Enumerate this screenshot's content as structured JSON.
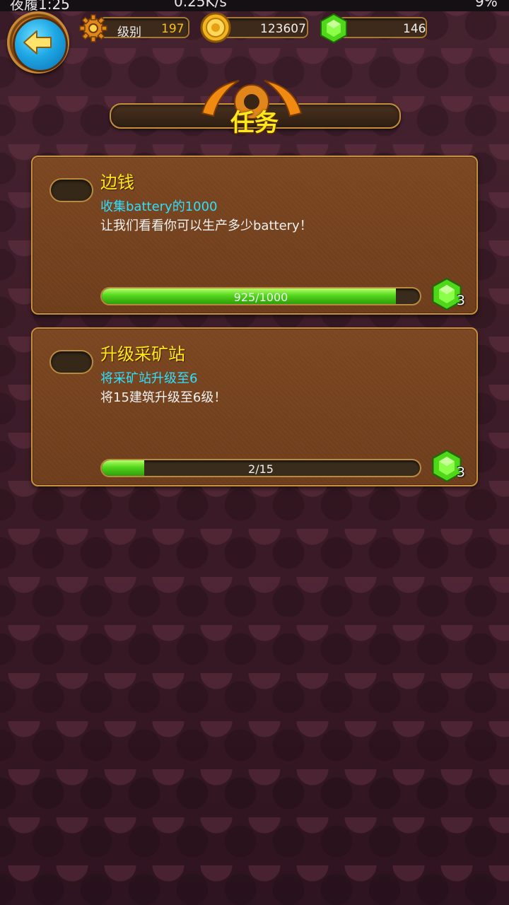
{
  "status_bar": {
    "left": "夜履1:25",
    "center": "0.25K/s",
    "right": "9%"
  },
  "header": {
    "level_label": "级别",
    "level_value": "197",
    "coins": "123607",
    "gems": "146"
  },
  "title": "任务",
  "quests": [
    {
      "title": "边钱",
      "subtitle": "收集battery的1000",
      "description": "让我们看看你可以生产多少battery！",
      "progress_text": "925/1000",
      "progress_fraction": 0.925,
      "reward": "3",
      "reward_icon": "gem-icon"
    },
    {
      "title": "升级采矿站",
      "subtitle": "将采矿站升级至6",
      "description": "将15建筑升级至6级！",
      "progress_text": "2/15",
      "progress_fraction": 0.1333,
      "reward": "3",
      "reward_icon": "gem-icon"
    }
  ],
  "colors": {
    "accent_yellow": "#ffe81a",
    "cyan_text": "#2fdfff",
    "progress_green": "#52d61c",
    "card_brown": "#7b4621",
    "border_gold": "#c8913e"
  }
}
